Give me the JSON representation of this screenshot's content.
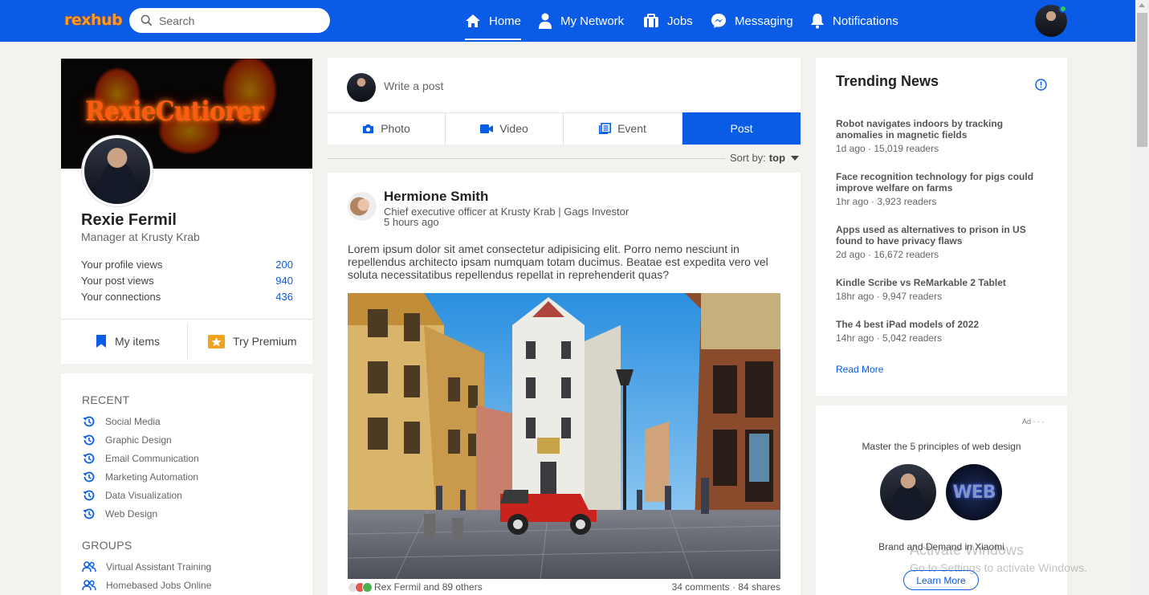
{
  "header": {
    "logo": "rexhub",
    "search_placeholder": "Search",
    "nav": [
      {
        "label": "Home",
        "icon": "home-icon",
        "active": true
      },
      {
        "label": "My Network",
        "icon": "person-icon"
      },
      {
        "label": "Jobs",
        "icon": "briefcase-icon"
      },
      {
        "label": "Messaging",
        "icon": "messenger-icon"
      },
      {
        "label": "Notifications",
        "icon": "bell-icon"
      }
    ]
  },
  "profile": {
    "cover_text": "RexieCutiorer",
    "name": "Rexie Fermil",
    "title": "Manager at Krusty Krab",
    "stats": [
      {
        "label": "Your profile views",
        "value": "200"
      },
      {
        "label": "Your post views",
        "value": "940"
      },
      {
        "label": "Your connections",
        "value": "436"
      }
    ],
    "my_items": "My items",
    "try_premium": "Try Premium"
  },
  "recent": {
    "heading": "RECENT",
    "items": [
      "Social Media",
      "Graphic Design",
      "Email Communication",
      "Marketing Automation",
      "Data Visualization",
      "Web Design"
    ]
  },
  "groups": {
    "heading": "GROUPS",
    "items": [
      "Virtual Assistant Training",
      "Homebased Jobs Online"
    ]
  },
  "composer": {
    "placeholder": "Write a post",
    "tabs": [
      {
        "label": "Photo",
        "icon": "camera-icon"
      },
      {
        "label": "Video",
        "icon": "video-icon"
      },
      {
        "label": "Event",
        "icon": "calendar-icon"
      }
    ],
    "post_button": "Post"
  },
  "sort": {
    "label": "Sort by:",
    "value": "top"
  },
  "post": {
    "author": "Hermione Smith",
    "subtitle": "Chief executive officer at Krusty Krab | Gags Investor",
    "time": "5 hours ago",
    "body": "Lorem ipsum dolor sit amet consectetur adipisicing elit. Porro nemo nesciunt in repellendus architecto ipsam numquam totam ducimus. Beatae est expedita vero vel soluta necessitatibus repellendus repellat in reprehenderit quas?",
    "reactions_text": "Rex Fermil and 89 others",
    "engagement_text": "34 comments · 84 shares"
  },
  "trending": {
    "title": "Trending News",
    "items": [
      {
        "title": "Robot navigates indoors by tracking anomalies in magnetic fields",
        "meta": "1d ago · 15,019 readers"
      },
      {
        "title": "Face recognition technology for pigs could improve welfare on farms",
        "meta": "1hr ago · 3,923 readers"
      },
      {
        "title": "Apps used as alternatives to prison in US found to have privacy flaws",
        "meta": "2d ago · 16,672 readers"
      },
      {
        "title": "Kindle Scribe vs ReMarkable 2 Tablet",
        "meta": "18hr ago · 9,947 readers"
      },
      {
        "title": "The 4 best iPad models of 2022",
        "meta": "14hr ago · 5,042 readers"
      }
    ],
    "read_more": "Read More"
  },
  "ad": {
    "label": "Ad · · ·",
    "headline": "Master the 5 principles of web design",
    "logo_text": "WEB",
    "caption": "Brand and Demand in Xiaomi",
    "button": "Learn More"
  },
  "watermark": {
    "line1": "Activate Windows",
    "line2": "Go to Settings to activate Windows."
  },
  "colors": {
    "brand": "#0a5ce6",
    "background": "#f3f2ef",
    "logo": "#ff9a1a"
  }
}
